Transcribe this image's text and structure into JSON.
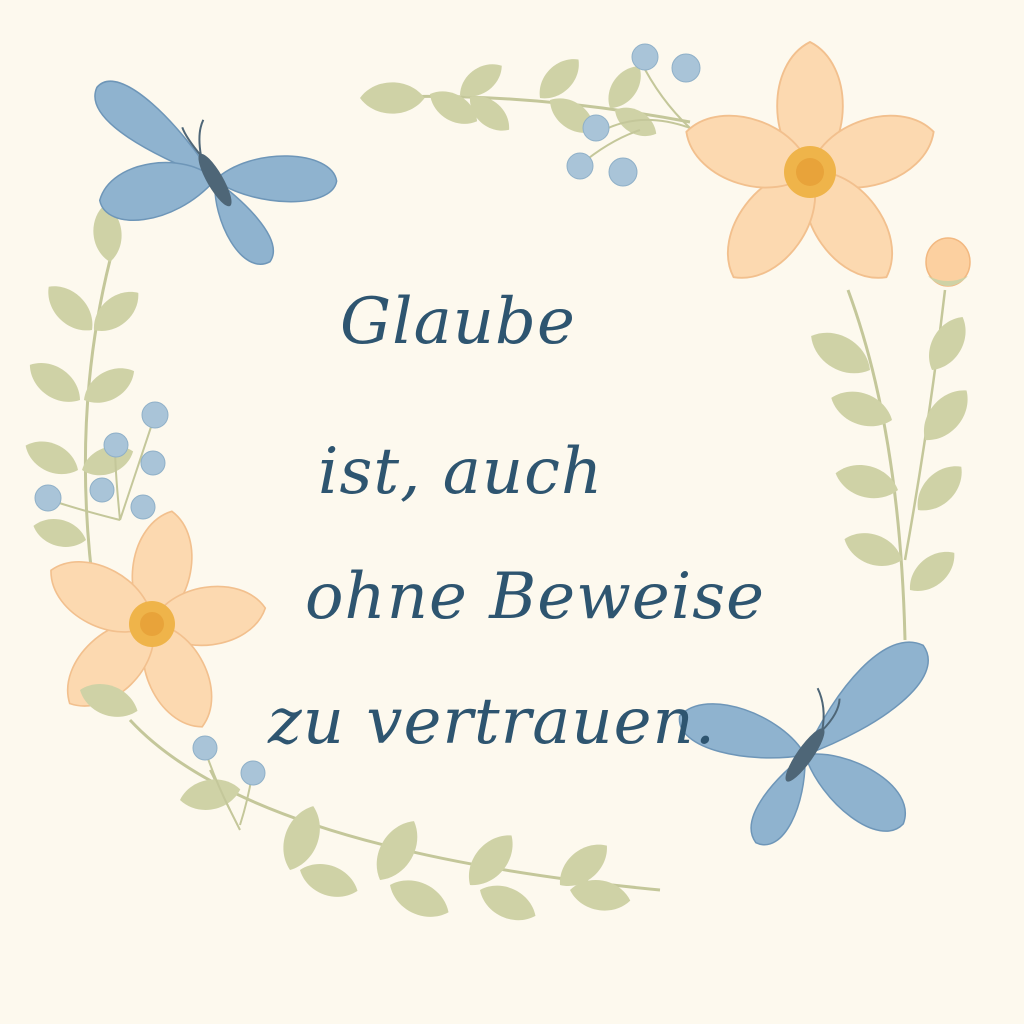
{
  "quote": {
    "lines": [
      "Glaube",
      "ist, auch",
      "ohne Beweise",
      "zu vertrauen."
    ]
  },
  "colors": {
    "background": "#fdf9ee",
    "text": "#2e5570",
    "leaf": "#cfd2a6",
    "leaf_stem": "#c4c79a",
    "petal": "#fcd9b0",
    "petal_edge": "#f2c08e",
    "flower_center": "#efb44a",
    "butterfly_wing": "#8fb3cf",
    "butterfly_wing_dark": "#6e96b8",
    "butterfly_body": "#4e6677",
    "berry": "#a9c4d8"
  },
  "icons": [
    "butterfly-icon",
    "flower-icon",
    "leaf-branch-icon",
    "berry-icon"
  ]
}
